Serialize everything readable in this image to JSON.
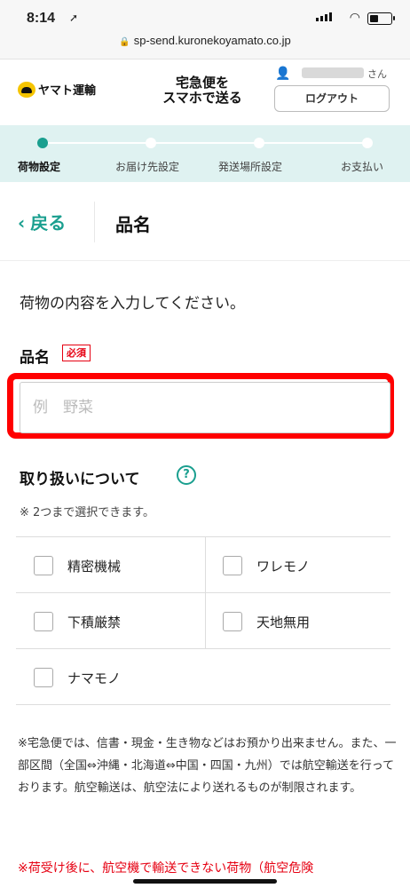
{
  "status": {
    "time": "8:14"
  },
  "browser": {
    "url": "sp-send.kuronekoyamato.co.jp"
  },
  "header": {
    "logo_text": "ヤマト運輸",
    "service_line1": "宅急便を",
    "service_line2": "スマホで送る",
    "user_suffix": "さん",
    "logout_label": "ログアウト"
  },
  "steps": [
    {
      "label": "荷物設定",
      "active": true
    },
    {
      "label": "お届け先設定",
      "active": false
    },
    {
      "label": "発送場所設定",
      "active": false
    },
    {
      "label": "お支払い",
      "active": false
    }
  ],
  "nav": {
    "back_label": "戻る",
    "page_title": "品名"
  },
  "content": {
    "intro": "荷物の内容を入力してください。",
    "item_label": "品名",
    "required_badge": "必須",
    "item_placeholder": "例　野菜",
    "handling_title": "取り扱いについて",
    "handling_note": "※ 2つまで選択できます。",
    "options": [
      "精密機械",
      "ワレモノ",
      "下積厳禁",
      "天地無用",
      "ナマモノ"
    ],
    "footnote": "※宅急便では、信書・現金・生き物などはお預かり出来ません。また、一部区間（全国⇔沖縄・北海道⇔中国・四国・九州）では航空輸送を行っております。航空輸送は、航空法により送れるものが制限されます。",
    "warning": "※荷受け後に、航空機で輸送できない荷物（航空危険"
  },
  "colors": {
    "accent": "#1a9f8f",
    "required": "#e60012",
    "highlight": "#ff0000",
    "steps_bg": "#dff2f1"
  }
}
